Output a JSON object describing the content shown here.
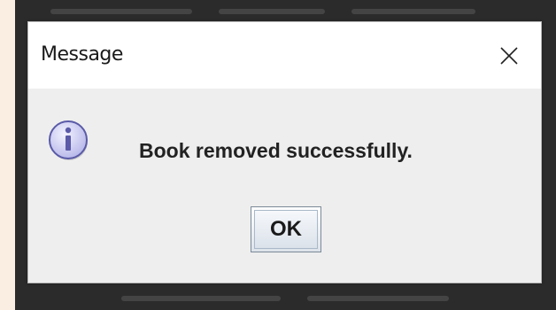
{
  "dialog": {
    "title": "Message",
    "message": "Book removed successfully.",
    "ok_label": "OK"
  },
  "icons": {
    "close": "close-icon",
    "info": "info-icon"
  },
  "colors": {
    "page_background": "#faeee2",
    "backdrop": "#2b2b2b",
    "dialog_body": "#eeeeee",
    "titlebar": "#ffffff",
    "info_icon_fill": "#c9c9f0",
    "info_icon_stroke": "#5a5aa8"
  }
}
